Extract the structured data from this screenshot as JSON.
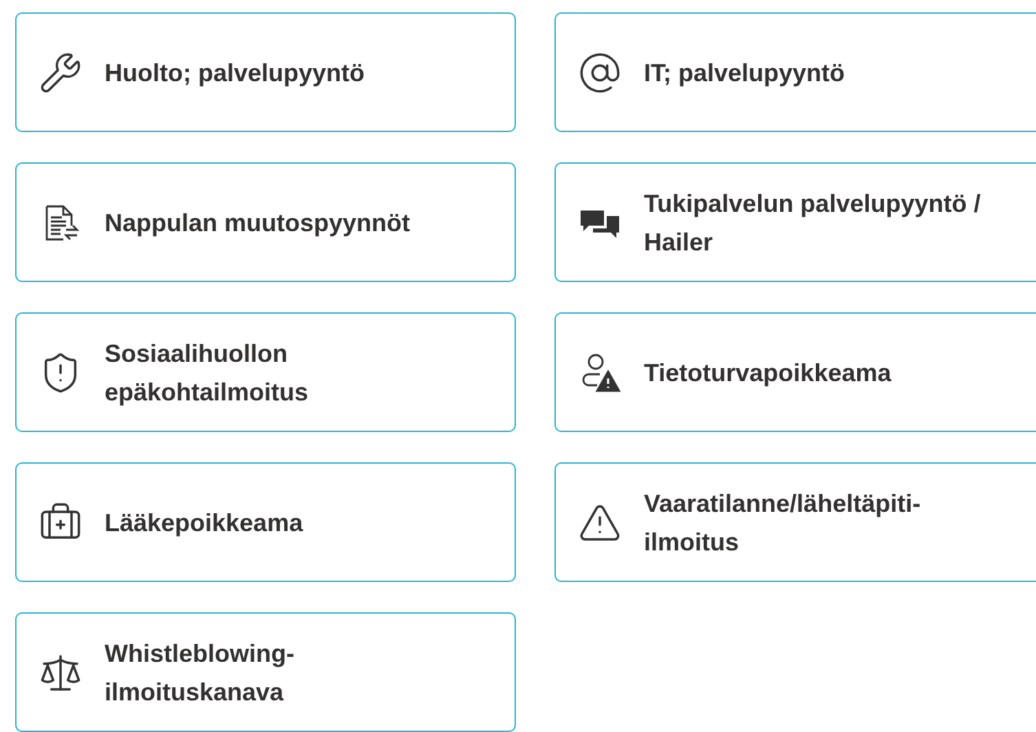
{
  "rows": [
    {
      "cards": [
        {
          "label": "Huolto; palvelupyyntö"
        },
        {
          "label": "IT; palvelupyyntö"
        }
      ]
    },
    {
      "cards": [
        {
          "label": "Nappulan muutospyynnöt"
        },
        {
          "label": "Tukipalvelun palvelupyyntö / Hailer"
        }
      ]
    },
    {
      "cards": [
        {
          "label": "Sosiaalihuollon epäkohtailmoitus"
        },
        {
          "label": "Tietoturvapoikkeama"
        }
      ]
    },
    {
      "cards": [
        {
          "label": "Lääkepoikkeama"
        },
        {
          "label": "Vaaratilanne/läheltäpiti-ilmoitus"
        }
      ]
    },
    {
      "cards": [
        {
          "label": "Whistleblowing-ilmoituskanava"
        }
      ]
    }
  ]
}
